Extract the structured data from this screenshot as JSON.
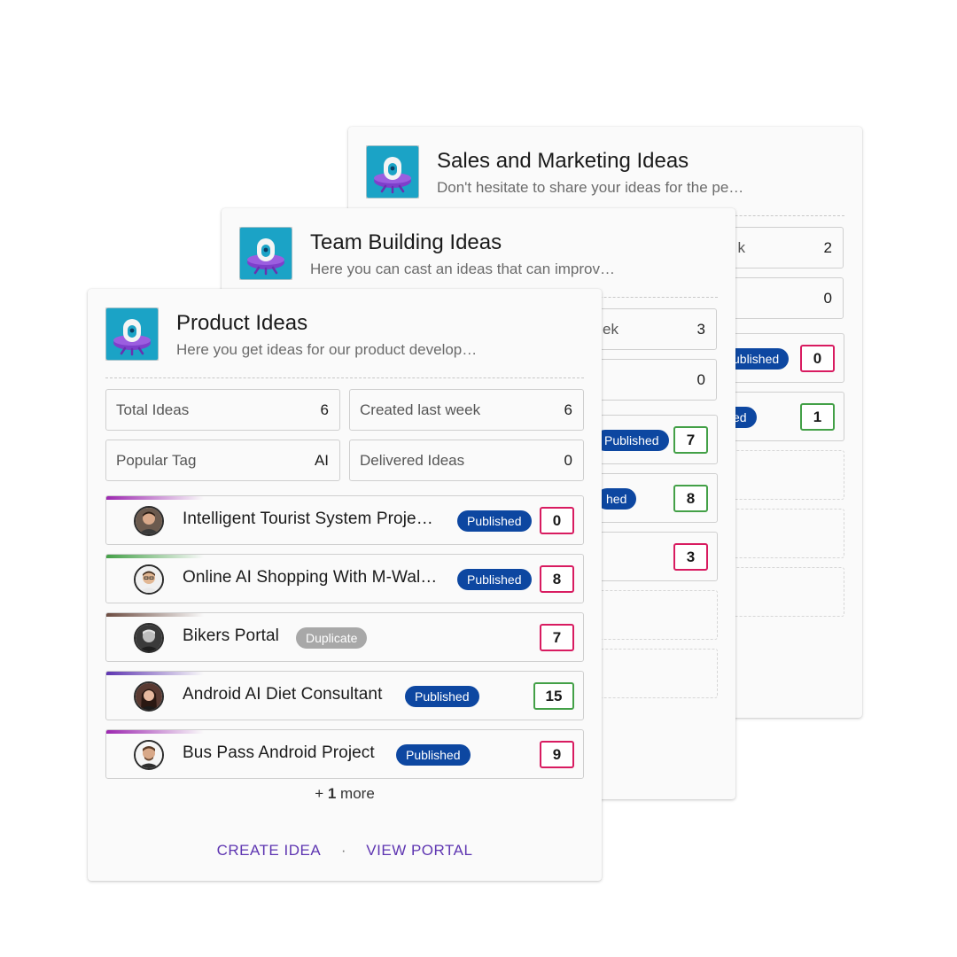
{
  "colors": {
    "published": "#0d47a1",
    "duplicate": "#a8a8a8",
    "votes_red": "#d81b60",
    "votes_green": "#43a047",
    "action": "#5e35b1",
    "icon_teal": "#1ba3c6",
    "icon_purple": "#7e3fcb"
  },
  "cards": {
    "sales": {
      "icon": "ufo-robot-icon",
      "title": "Sales and Marketing Ideas",
      "subtitle": "Don't hesitate to share your ideas for the pe…",
      "stats": [
        {
          "label": "k",
          "value": "2"
        },
        {
          "label": "",
          "value": "0"
        }
      ],
      "rows": [
        {
          "status": "ublished",
          "votes": "0"
        },
        {
          "status": "ed",
          "votes": "1"
        }
      ]
    },
    "team": {
      "icon": "ufo-robot-icon",
      "title": "Team Building Ideas",
      "subtitle": "Here you can cast an ideas that can improv…",
      "stats": [
        {
          "label": "ek",
          "value": "3"
        },
        {
          "label": "",
          "value": "0"
        }
      ],
      "rows": [
        {
          "status": "Published",
          "votes": "7"
        },
        {
          "status": "hed",
          "votes": "8"
        },
        {
          "status": "",
          "votes": "3"
        }
      ]
    },
    "product": {
      "icon": "ufo-robot-icon",
      "title": "Product Ideas",
      "subtitle": "Here you get ideas for our product develop…",
      "stats": [
        {
          "label": "Total Ideas",
          "value": "6"
        },
        {
          "label": "Created last week",
          "value": "6"
        },
        {
          "label": "Popular Tag",
          "value": "AI"
        },
        {
          "label": "Delivered Ideas",
          "value": "0"
        }
      ],
      "ideas": [
        {
          "title": "Intelligent Tourist System Proje…",
          "status": "Published",
          "votes": "0",
          "accent": "#9c27b0",
          "avatar": "person-avatar"
        },
        {
          "title": "Online AI Shopping With M-Wal…",
          "status": "Published",
          "votes": "8",
          "accent": "#43a047",
          "avatar": "person-avatar"
        },
        {
          "title": "Bikers Portal",
          "status": "Duplicate",
          "votes": "7",
          "accent": "#6d4c41",
          "avatar": "person-avatar"
        },
        {
          "title": "Android AI Diet Consultant",
          "status": "Published",
          "votes": "15",
          "accent": "#5e35b1",
          "avatar": "person-avatar"
        },
        {
          "title": "Bus Pass Android Project",
          "status": "Published",
          "votes": "9",
          "accent": "#9c27b0",
          "avatar": "person-avatar"
        }
      ],
      "more_prefix": "+ ",
      "more_count": "1",
      "more_suffix": " more",
      "actions": {
        "create": "CREATE IDEA",
        "separator": "·",
        "view": "VIEW PORTAL"
      }
    }
  }
}
